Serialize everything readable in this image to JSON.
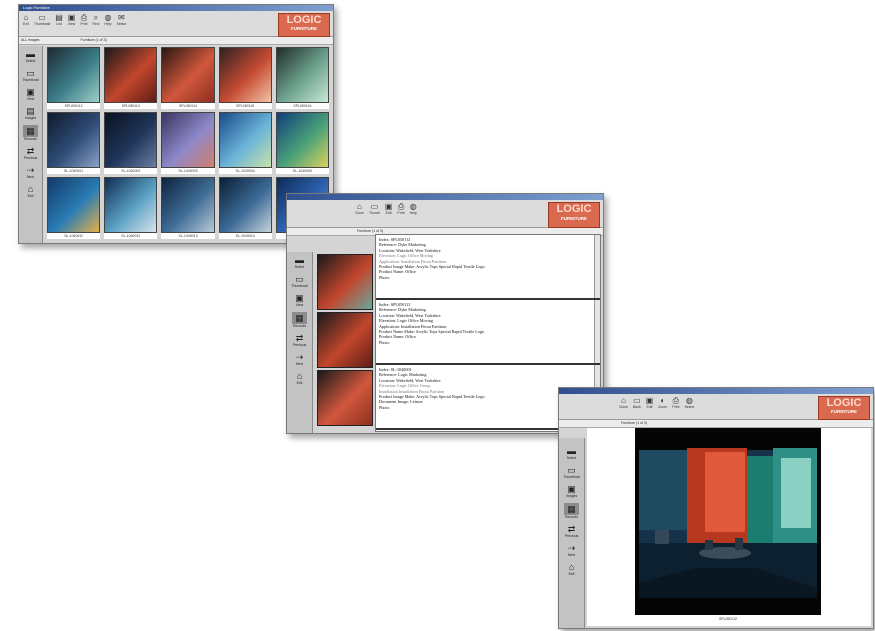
{
  "win1": {
    "title": "Logic Furniture",
    "toolbar": [
      {
        "icon": "⌂",
        "label": "Exit"
      },
      {
        "icon": "▭",
        "label": "Thumbnail"
      },
      {
        "icon": "▤",
        "label": "List"
      },
      {
        "icon": "▣",
        "label": "View"
      },
      {
        "icon": "⎙",
        "label": "Print"
      },
      {
        "icon": "⌕",
        "label": "Find"
      },
      {
        "icon": "◍",
        "label": "Help"
      },
      {
        "icon": "✉",
        "label": "Select"
      }
    ],
    "strip_left": "ALL Images",
    "strip_mid": "Furniture (1 of 3)",
    "side": [
      {
        "icon": "▬",
        "label": "Select"
      },
      {
        "icon": "▭",
        "label": "Thumbnail"
      },
      {
        "icon": "▣",
        "label": "View"
      },
      {
        "icon": "▤",
        "label": "Images"
      },
      {
        "icon": "▦",
        "label": "Records"
      },
      {
        "icon": "⇄",
        "label": "Previous"
      },
      {
        "icon": "⇢",
        "label": "Next"
      },
      {
        "icon": "⌂",
        "label": "Exit"
      }
    ],
    "thumbs": [
      {
        "caption": "SPL050112",
        "colors": [
          "#1d2a33",
          "#3c7d8a",
          "#9fd0c8"
        ]
      },
      {
        "caption": "SPL050113",
        "colors": [
          "#1a1a1a",
          "#c2462d",
          "#5f1d14"
        ]
      },
      {
        "caption": "SPL050114",
        "colors": [
          "#2a1712",
          "#d0573c",
          "#8d2f1e"
        ]
      },
      {
        "caption": "SPL050115",
        "colors": [
          "#302020",
          "#c64c34",
          "#f2c3a6"
        ]
      },
      {
        "caption": "SPL050116",
        "colors": [
          "#1e2c2a",
          "#6fa48f",
          "#c8e6d6"
        ]
      },
      {
        "caption": "SL-1040001",
        "colors": [
          "#0f1a2e",
          "#2f4d78",
          "#8aa3c7"
        ]
      },
      {
        "caption": "SL-1040002",
        "colors": [
          "#0b1120",
          "#1f3559",
          "#6a7ea3"
        ]
      },
      {
        "caption": "SL-1040003",
        "colors": [
          "#3a3560",
          "#8d88c9",
          "#d37f6a"
        ]
      },
      {
        "caption": "SL-1040004",
        "colors": [
          "#1b4a8a",
          "#6ab4d9",
          "#c9e1a8"
        ]
      },
      {
        "caption": "SL-1040005",
        "colors": [
          "#103e7a",
          "#49a07a",
          "#d9d35a"
        ]
      },
      {
        "caption": "SL-1040011",
        "colors": [
          "#123a67",
          "#2a7bb5",
          "#e2b049"
        ]
      },
      {
        "caption": "SL-1040012",
        "colors": [
          "#0f2d52",
          "#5aa0c4",
          "#d8e3ea"
        ]
      },
      {
        "caption": "SL-1040013",
        "colors": [
          "#0f223e",
          "#3f6d96",
          "#b7c9d8"
        ]
      },
      {
        "caption": "SL-1040014",
        "colors": [
          "#0d1f38",
          "#3b6a96",
          "#c7d3dd"
        ]
      },
      {
        "caption": "SL-1040015",
        "colors": [
          "#0e2a55",
          "#2f66b6",
          "#90b6e6"
        ]
      }
    ]
  },
  "win2": {
    "toolbar": [
      {
        "icon": "⌂",
        "label": "Close"
      },
      {
        "icon": "▭",
        "label": "Thumb"
      },
      {
        "icon": "▣",
        "label": "Edit"
      },
      {
        "icon": "⎙",
        "label": "Print"
      },
      {
        "icon": "◍",
        "label": "Help"
      }
    ],
    "strip": "Furniture (1 of 3)",
    "side": [
      {
        "icon": "▬",
        "label": "Select"
      },
      {
        "icon": "▭",
        "label": "Thumbnail"
      },
      {
        "icon": "▣",
        "label": "View"
      },
      {
        "icon": "▦",
        "label": "Records"
      },
      {
        "icon": "⇄",
        "label": "Previous"
      },
      {
        "icon": "⇢",
        "label": "Next"
      },
      {
        "icon": "⌂",
        "label": "Exit"
      }
    ],
    "thumb_colors": [
      [
        "#1a1a1a",
        "#c2462d",
        "#6aa79c"
      ],
      [
        "#1a1a1a",
        "#c2462d",
        "#5f1d14"
      ],
      [
        "#1a1a1a",
        "#d0573c",
        "#8d2f1e"
      ]
    ],
    "records": [
      [
        "Index: SPL050112",
        "Reference: Dyke Marketing",
        "Location: Wakefield, West Yorkshire",
        "Elevation: Logic Office Moving",
        "Application: Installation    Fitout    Partition",
        "Product Image Make: Acrylic Tops    Special Rapid    Textile Logo",
        "Product Name: Office",
        "Photo:"
      ],
      [
        "Index: SPL050113",
        "Reference: Dyke Marketing",
        "Location: Wakefield, West Yorkshire",
        "Elevation: Logic Office Moving",
        "Application: Installation    Fitout    Partition",
        "Product Name Make: Acrylic Tops    Special Rapid    Textile Logo",
        "Product Name: Office",
        "Photo:"
      ],
      [
        "Index: SL-1040001",
        "Reference: Logic Marketing",
        "Location: Wakefield, West Yorkshire",
        "Elevation: Logic Office Group",
        "Installation    Installation    Fitout    Partition",
        "Product Image Make: Acrylic Tops    Special Rapid    Textile Logo",
        "Document Image: Leisure",
        "Photo:"
      ]
    ]
  },
  "win3": {
    "toolbar": [
      {
        "icon": "⌂",
        "label": "Close"
      },
      {
        "icon": "▭",
        "label": "Back"
      },
      {
        "icon": "▣",
        "label": "Edit"
      },
      {
        "icon": "◐",
        "label": "Zoom"
      },
      {
        "icon": "⎙",
        "label": "Print"
      },
      {
        "icon": "◍",
        "label": "Select"
      }
    ],
    "strip": "Furniture (1 of 3)",
    "side": [
      {
        "icon": "▬",
        "label": "Select"
      },
      {
        "icon": "▭",
        "label": "Thumbnail"
      },
      {
        "icon": "▣",
        "label": "Images"
      },
      {
        "icon": "▦",
        "label": "Records"
      },
      {
        "icon": "⇄",
        "label": "Previous"
      },
      {
        "icon": "⇢",
        "label": "Next"
      },
      {
        "icon": "⌂",
        "label": "Exit"
      }
    ],
    "caption": "SPL050112"
  },
  "logo": {
    "l1": "LOGIC",
    "l2": "FURNITURE"
  }
}
